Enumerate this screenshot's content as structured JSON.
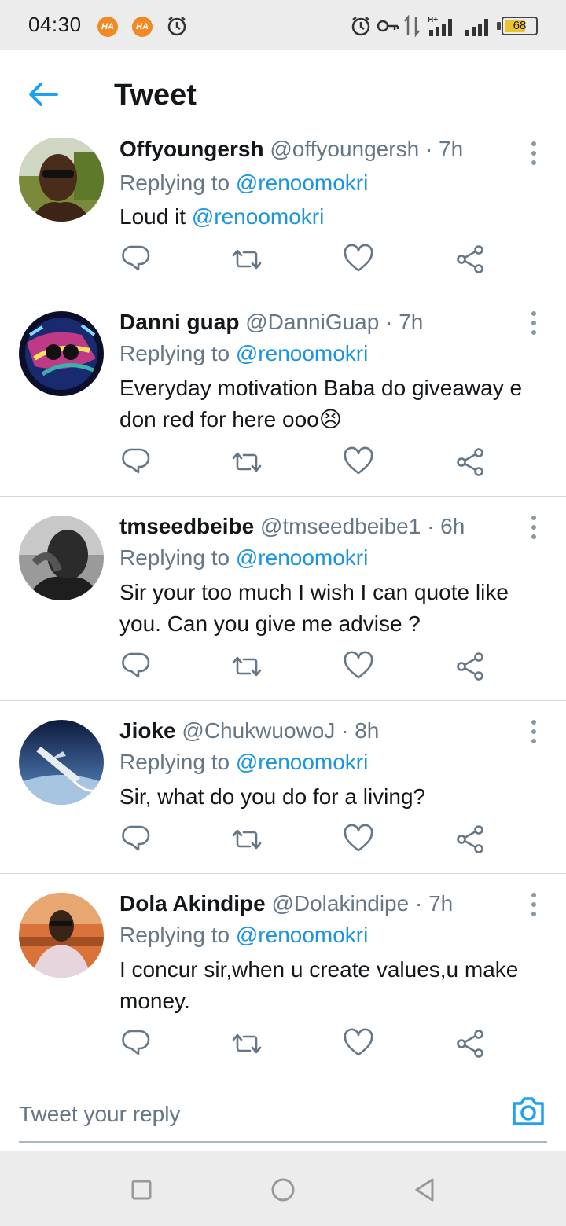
{
  "status_bar": {
    "time": "04:30",
    "badge_label": "HA",
    "battery_level": "68",
    "battery_fraction": 0.68
  },
  "header": {
    "title": "Tweet",
    "back_icon": "arrow-left-icon"
  },
  "tweets": [
    {
      "name": "Offyoungersh",
      "handle": "@offyoungersh",
      "dot": "·",
      "time": "7h",
      "replying_prefix": "Replying to",
      "replying_to": "@renoomokri",
      "text": "Loud it ",
      "text_mention": "@renoomokri"
    },
    {
      "name": "Danni guap",
      "handle": "@DanniGuap",
      "dot": "·",
      "time": "7h",
      "replying_prefix": "Replying to",
      "replying_to": "@renoomokri",
      "text": "Everyday motivation Baba do giveaway e don red for here ooo",
      "emoji": "😣"
    },
    {
      "name": "tmseedbeibe",
      "handle": "@tmseedbeibe1",
      "dot": "·",
      "time": "6h",
      "replying_prefix": "Replying to",
      "replying_to": "@renoomokri",
      "text": "Sir your too much I wish I can  quote like you. Can you give me advise ?"
    },
    {
      "name": "Jioke",
      "handle": "@ChukwuowoJ",
      "dot": "·",
      "time": "8h",
      "replying_prefix": "Replying to",
      "replying_to": "@renoomokri",
      "text": "Sir, what do you do for a living?"
    },
    {
      "name": "Dola Akindipe",
      "handle": "@Dolakindipe",
      "dot": "·",
      "time": "7h",
      "replying_prefix": "Replying to",
      "replying_to": "@renoomokri",
      "text": "I concur sir,when u create values,u make money."
    }
  ],
  "action_icons": [
    "reply-icon",
    "retweet-icon",
    "like-icon",
    "share-icon"
  ],
  "reply_bar": {
    "placeholder": "Tweet your reply",
    "camera_icon": "camera-icon"
  },
  "nav_bar": {
    "icons": [
      "recents-square-icon",
      "home-circle-icon",
      "back-triangle-icon"
    ]
  },
  "colors": {
    "accent": "#1b95e0",
    "secondary_text": "#657786",
    "primary_text": "#14171a",
    "divider": "#cfd9de"
  }
}
